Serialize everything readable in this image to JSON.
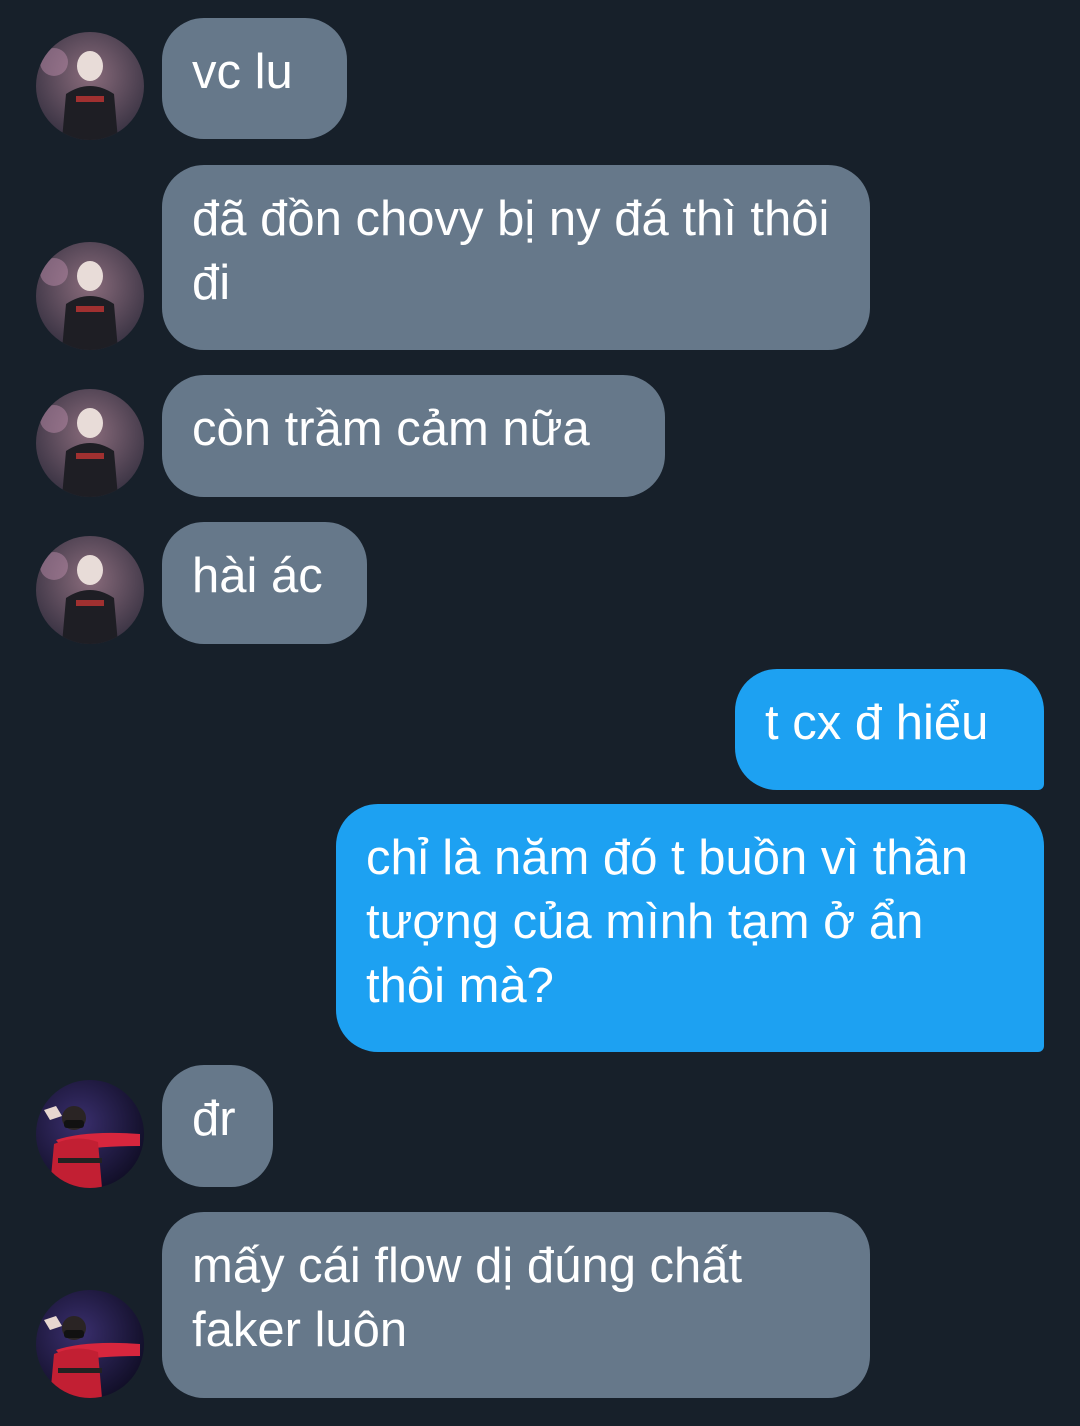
{
  "conversation": {
    "messages": [
      {
        "sender": "other",
        "text": "vc lu",
        "avatar": "avatar-a"
      },
      {
        "sender": "other",
        "text": "đã đồn chovy bị ny đá thì thôi đi",
        "avatar": "avatar-a"
      },
      {
        "sender": "other",
        "text": "còn trầm cảm nữa",
        "avatar": "avatar-a"
      },
      {
        "sender": "other",
        "text": "hài ác",
        "avatar": "avatar-a"
      },
      {
        "sender": "me",
        "text": "t cx đ hiểu"
      },
      {
        "sender": "me",
        "text": "chỉ là năm đó t buồn vì thần tượng của mình tạm ở ẩn thôi mà?"
      },
      {
        "sender": "other",
        "text": "đr",
        "avatar": "avatar-b"
      },
      {
        "sender": "other",
        "text": "mấy cái flow dị đúng chất faker luôn",
        "avatar": "avatar-b"
      }
    ]
  },
  "colors": {
    "background": "#17202a",
    "incoming_bubble": "#66788a",
    "outgoing_bubble": "#1da1f2",
    "text": "#ffffff"
  }
}
